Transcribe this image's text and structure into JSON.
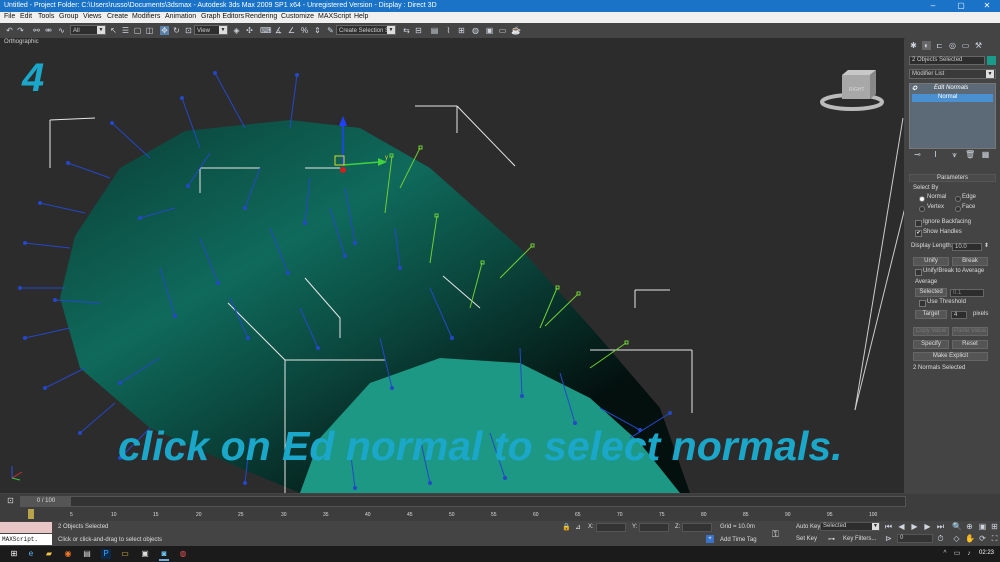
{
  "window": {
    "title": "Untitled    - Project Folder: C:\\Users\\russo\\Documents\\3dsmax     - Autodesk 3ds Max  2009 SP1  x64   - Unregistered Version     - Display : Direct 3D",
    "min_label": "–",
    "max_label": "▢",
    "close_label": "✕"
  },
  "menu": [
    "File",
    "Edit",
    "Tools",
    "Group",
    "Views",
    "Create",
    "Modifiers",
    "Animation",
    "Graph Editors",
    "Rendering",
    "Customize",
    "MAXScript",
    "Help"
  ],
  "toolbar": {
    "selection_filter": "All",
    "ref_coord": "View",
    "named_selection": "Create Selection Se"
  },
  "viewport": {
    "label": "Orthographic",
    "step_number": "4",
    "caption": "click on Ed normal to select normals.",
    "viewcube_label": "RIGHT",
    "gizmo_y": "y"
  },
  "command_panel": {
    "object_name": "2 Objects Selected",
    "modifier_list": "Modifier List",
    "stack": [
      "Edit Normals",
      "Normal"
    ],
    "rollout_title": "Parameters",
    "select_by_label": "Select By",
    "select_by": [
      {
        "label": "Normal",
        "on": true
      },
      {
        "label": "Edge",
        "on": false
      },
      {
        "label": "Vertex",
        "on": false
      },
      {
        "label": "Face",
        "on": false
      }
    ],
    "ignore_backfacing": "Ignore Backfacing",
    "show_handles": "Show Handles",
    "display_length_label": "Display Length:",
    "display_length": "10.0",
    "unify": "Unify",
    "break": "Break",
    "unify_break_avg": "Unify/Break to Average",
    "average_label": "Average",
    "selected_btn": "Selected",
    "selected_val": "0.1",
    "use_threshold": "Use Threshold",
    "target_btn": "Target",
    "target_val": "4",
    "pixels": "pixels",
    "copy_value": "Copy Value",
    "paste_value": "Paste Value",
    "specify": "Specify",
    "reset": "Reset",
    "make_explicit": "Make Explicit",
    "status": "2 Normals Selected"
  },
  "timeline": {
    "frame_display": "0 / 100",
    "ticks": [
      "0",
      "5",
      "10",
      "15",
      "20",
      "25",
      "30",
      "35",
      "40",
      "45",
      "50",
      "55",
      "60",
      "65",
      "70",
      "75",
      "80",
      "85",
      "90",
      "95",
      "100"
    ]
  },
  "status": {
    "maxscript": "MAXScript.",
    "objects_selected": "2 Objects Selected",
    "prompt": "Click or click-and-drag to select objects",
    "x_label": "X:",
    "y_label": "Y:",
    "z_label": "Z:",
    "grid": "Grid = 10.0m",
    "add_time_tag": "Add Time Tag",
    "auto_key": "Auto Key",
    "set_key": "Set Key",
    "key_mode": "Selected",
    "key_filters": "Key Filters...",
    "current_frame": "0"
  },
  "taskbar": {
    "time": "02:23"
  },
  "colors": {
    "accent": "#1a73c7",
    "caption": "#1aa7c9",
    "object_dark": "#0f5c4f",
    "object_light": "#1a9a88",
    "step_number": "#1aa7c9"
  }
}
